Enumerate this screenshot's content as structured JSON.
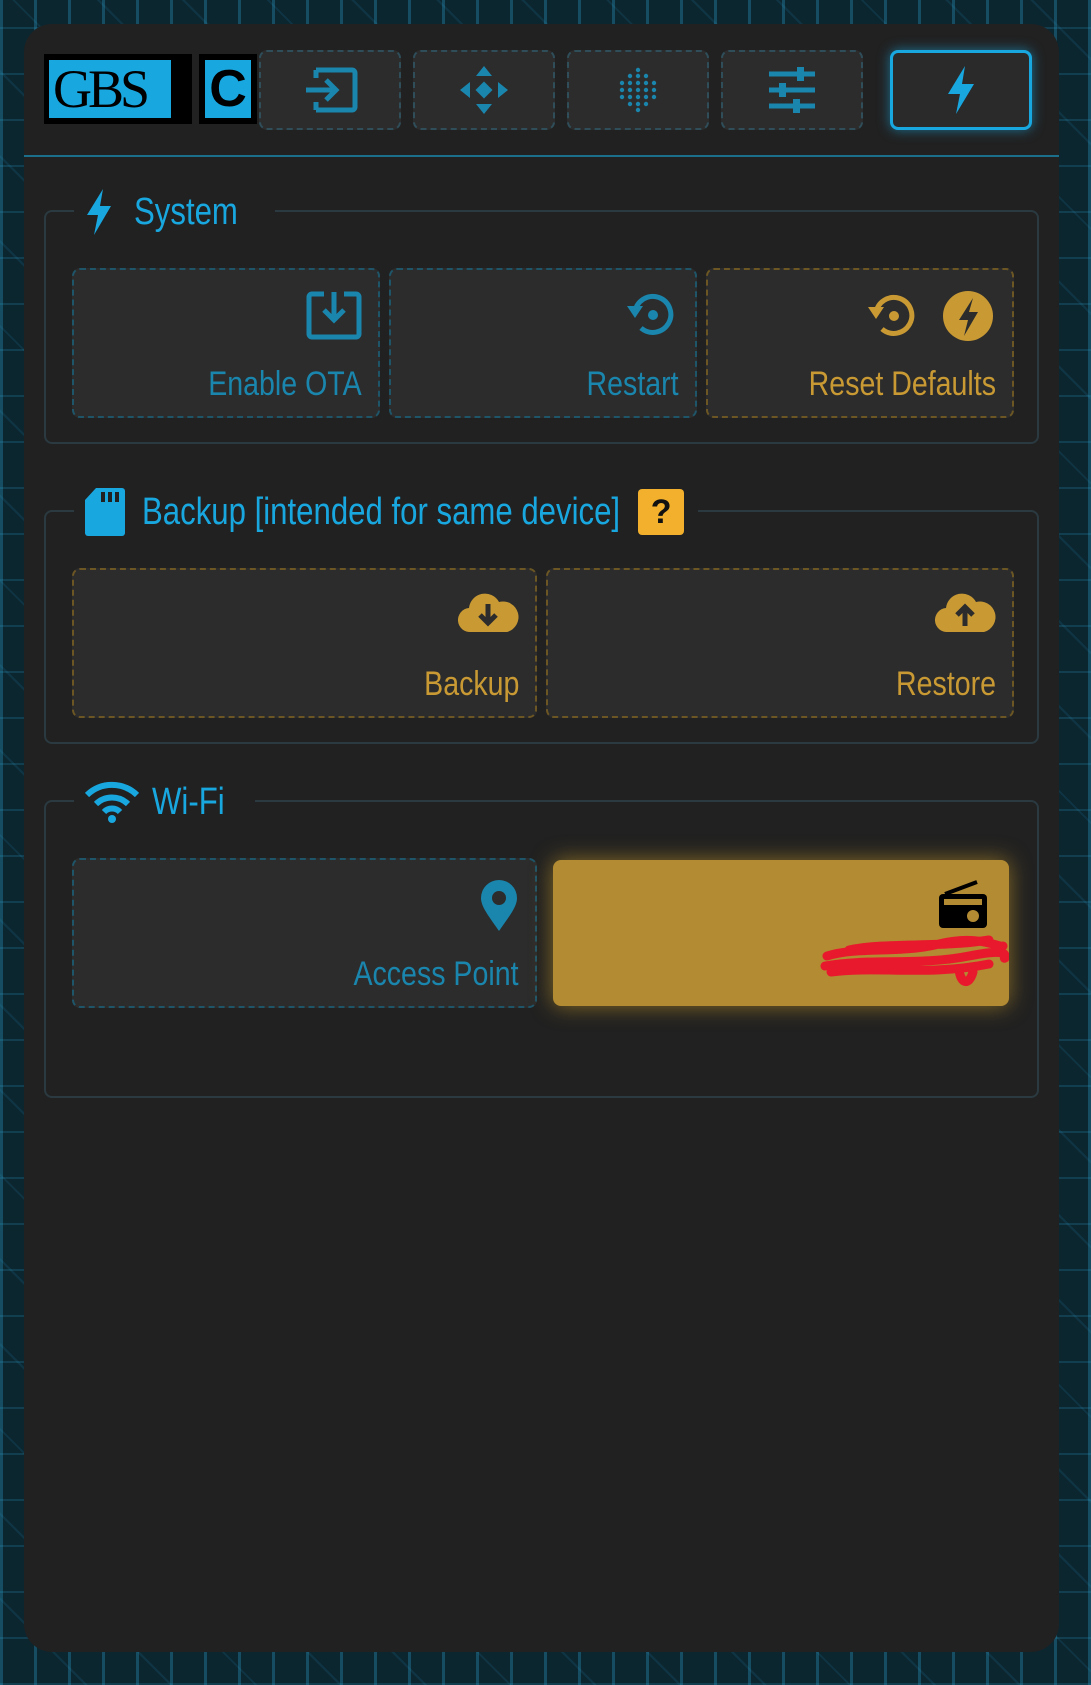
{
  "logo": {
    "left": "GBS",
    "right": "C"
  },
  "tabs": [
    {
      "name": "tab-input",
      "icon": "input-icon",
      "active": false
    },
    {
      "name": "tab-position",
      "icon": "move-icon",
      "active": false
    },
    {
      "name": "tab-filters",
      "icon": "dots-grid-icon",
      "active": false
    },
    {
      "name": "tab-preferences",
      "icon": "sliders-icon",
      "active": false
    },
    {
      "name": "tab-system",
      "icon": "bolt-icon",
      "active": true
    }
  ],
  "system": {
    "title": "System",
    "buttons": [
      {
        "label": "Enable OTA",
        "icon": "download-box-icon"
      },
      {
        "label": "Restart",
        "icon": "restart-icon"
      },
      {
        "label": "Reset Defaults",
        "icon": "restart-bolt-icon"
      }
    ]
  },
  "backup": {
    "title": "Backup [intended for same device]",
    "help": "?",
    "buttons": [
      {
        "label": "Backup",
        "icon": "cloud-download-icon"
      },
      {
        "label": "Restore",
        "icon": "cloud-upload-icon"
      }
    ]
  },
  "wifi": {
    "title": "Wi-Fi",
    "buttons": [
      {
        "label": "Access Point",
        "icon": "map-pin-icon"
      },
      {
        "label": "",
        "icon": "radio-icon",
        "active": true
      }
    ]
  },
  "colors": {
    "accent_blue": "#19a7e0",
    "accent_gold": "#f2b02c",
    "panel_bg": "#212121"
  }
}
